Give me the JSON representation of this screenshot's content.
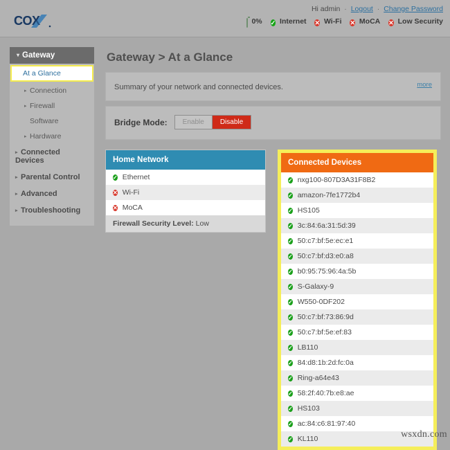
{
  "header": {
    "logo_text": "COX",
    "greeting": "Hi admin",
    "logout_label": "Logout",
    "change_password_label": "Change Password",
    "separator": "·",
    "status": [
      {
        "label": "0%",
        "icon": "battery-icon",
        "state": "neutral"
      },
      {
        "label": "Internet",
        "icon": "check-circle-icon",
        "state": "ok"
      },
      {
        "label": "Wi-Fi",
        "icon": "error-circle-icon",
        "state": "bad"
      },
      {
        "label": "MoCA",
        "icon": "error-circle-icon",
        "state": "bad"
      },
      {
        "label": "Low Security",
        "icon": "error-circle-icon",
        "state": "bad"
      }
    ]
  },
  "sidebar": {
    "top": {
      "label": "Gateway",
      "caret": "▾"
    },
    "active": {
      "label": "At a Glance"
    },
    "items": [
      {
        "label": "Connection",
        "caret": "▸",
        "level": "sub",
        "major": false
      },
      {
        "label": "Firewall",
        "caret": "▸",
        "level": "sub",
        "major": false
      },
      {
        "label": "Software",
        "caret": "",
        "level": "sub",
        "major": false
      },
      {
        "label": "Hardware",
        "caret": "▸",
        "level": "sub",
        "major": false
      },
      {
        "label": "Connected Devices",
        "caret": "▸",
        "level": "major",
        "major": true
      },
      {
        "label": "Parental Control",
        "caret": "▸",
        "level": "major",
        "major": true
      },
      {
        "label": "Advanced",
        "caret": "▸",
        "level": "major",
        "major": true
      },
      {
        "label": "Troubleshooting",
        "caret": "▸",
        "level": "major",
        "major": true
      }
    ]
  },
  "main": {
    "title": "Gateway > At a Glance",
    "summary_text": "Summary of your network and connected devices.",
    "more_label": "more",
    "bridge": {
      "label": "Bridge Mode:",
      "enable_label": "Enable",
      "disable_label": "Disable"
    }
  },
  "home_network": {
    "title": "Home Network",
    "rows": [
      {
        "label": "Ethernet",
        "state": "ok",
        "icon": "check-circle-icon"
      },
      {
        "label": "Wi-Fi",
        "state": "bad",
        "icon": "error-circle-icon"
      },
      {
        "label": "MoCA",
        "state": "bad",
        "icon": "error-circle-icon"
      }
    ],
    "firewall_label": "Firewall Security Level:",
    "firewall_value": "Low"
  },
  "connected_devices": {
    "title": "Connected Devices",
    "devices": [
      {
        "name": "nxg100-807D3A31F8B2",
        "state": "ok"
      },
      {
        "name": "amazon-7fe1772b4",
        "state": "ok"
      },
      {
        "name": "HS105",
        "state": "ok"
      },
      {
        "name": "3c:84:6a:31:5d:39",
        "state": "ok"
      },
      {
        "name": "50:c7:bf:5e:ec:e1",
        "state": "ok"
      },
      {
        "name": "50:c7:bf:d3:e0:a8",
        "state": "ok"
      },
      {
        "name": "b0:95:75:96:4a:5b",
        "state": "ok"
      },
      {
        "name": "S-Galaxy-9",
        "state": "ok"
      },
      {
        "name": "W550-0DF202",
        "state": "ok"
      },
      {
        "name": "50:c7:bf:73:86:9d",
        "state": "ok"
      },
      {
        "name": "50:c7:bf:5e:ef:83",
        "state": "ok"
      },
      {
        "name": "LB110",
        "state": "ok"
      },
      {
        "name": "84:d8:1b:2d:fc:0a",
        "state": "ok"
      },
      {
        "name": "Ring-a64e43",
        "state": "ok"
      },
      {
        "name": "58:2f:40:7b:e8:ae",
        "state": "ok"
      },
      {
        "name": "HS103",
        "state": "ok"
      },
      {
        "name": "ac:84:c6:81:97:40",
        "state": "ok"
      },
      {
        "name": "KL110",
        "state": "ok"
      }
    ]
  },
  "watermark": {
    "text": "wsxdn.com"
  },
  "colors": {
    "page_bg": "#a9a9a9",
    "topbar_bg": "#b3b3b3",
    "accent_blue": "#2f8cb2",
    "accent_orange": "#f06a13",
    "highlight_yellow": "#f5ee5a",
    "danger_red": "#cf2a18",
    "link_blue": "#2d6f9e",
    "ok_green": "#1ba01b",
    "bad_red": "#d8372b"
  }
}
